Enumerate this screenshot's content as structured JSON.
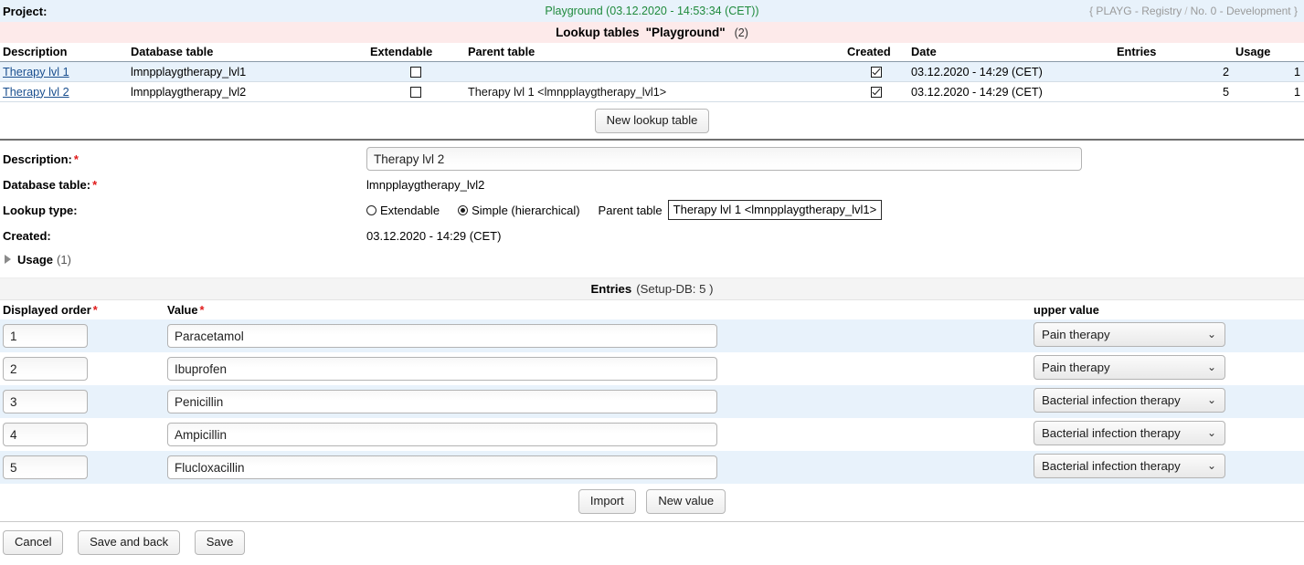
{
  "header": {
    "project_label": "Project:",
    "project_name": "Playground (03.12.2020 - 14:53:34 (CET))",
    "registry_code": "{ PLAYG - Registry",
    "registry_sep": "/",
    "registry_env": "No. 0 - Development  }"
  },
  "section": {
    "title": "Lookup tables",
    "quoted": "\"Playground\"",
    "count": "(2)"
  },
  "lookup_table": {
    "columns": {
      "description": "Description",
      "database_table": "Database table",
      "extendable": "Extendable",
      "parent_table": "Parent table",
      "created": "Created",
      "date": "Date",
      "entries": "Entries",
      "usage": "Usage"
    },
    "rows": [
      {
        "description": "Therapy lvl 1",
        "database_table": "lmnpplaygtherapy_lvl1",
        "extendable": false,
        "parent_table": "",
        "created": true,
        "date": "03.12.2020 - 14:29 (CET)",
        "entries": "2",
        "usage": "1"
      },
      {
        "description": "Therapy lvl 2",
        "database_table": "lmnpplaygtherapy_lvl2",
        "extendable": false,
        "parent_table": "Therapy lvl 1  <lmnpplaygtherapy_lvl1>",
        "created": true,
        "date": "03.12.2020 - 14:29 (CET)",
        "entries": "5",
        "usage": "1"
      }
    ],
    "new_button": "New lookup table"
  },
  "detail": {
    "description_label": "Description:",
    "description_value": "Therapy lvl 2",
    "database_table_label": "Database table:",
    "database_table_value": "lmnpplaygtherapy_lvl2",
    "lookup_type_label": "Lookup type:",
    "radio_extendable": "Extendable",
    "radio_simple": "Simple (hierarchical)",
    "radio_selected": "simple",
    "parent_table_label": "Parent table",
    "parent_table_value": "Therapy lvl 1 <lmnpplaygtherapy_lvl1>",
    "created_label": "Created:",
    "created_value": "03.12.2020 - 14:29 (CET)",
    "usage_label": "Usage",
    "usage_count": "(1)"
  },
  "entries": {
    "bar_title": "Entries",
    "bar_count": "(Setup-DB: 5 )",
    "columns": {
      "order": "Displayed order",
      "value": "Value",
      "upper_value": "upper value"
    },
    "rows": [
      {
        "order": "1",
        "value": "Paracetamol",
        "upper": "Pain therapy"
      },
      {
        "order": "2",
        "value": "Ibuprofen",
        "upper": "Pain therapy"
      },
      {
        "order": "3",
        "value": "Penicillin",
        "upper": "Bacterial infection therapy"
      },
      {
        "order": "4",
        "value": "Ampicillin",
        "upper": "Bacterial infection therapy"
      },
      {
        "order": "5",
        "value": "Flucloxacillin",
        "upper": "Bacterial infection therapy"
      }
    ],
    "import_button": "Import",
    "new_value_button": "New value",
    "chevron": "⌄"
  },
  "footer": {
    "cancel": "Cancel",
    "save_and_back": "Save and back",
    "save": "Save"
  },
  "colors": {
    "project_bar": "#e8f2fb",
    "project_name": "#1f8a3c",
    "section_bar": "#fdeaea",
    "row_alt": "#e8f2fb",
    "required": "#e01b1b",
    "link": "#1a4f8f"
  }
}
